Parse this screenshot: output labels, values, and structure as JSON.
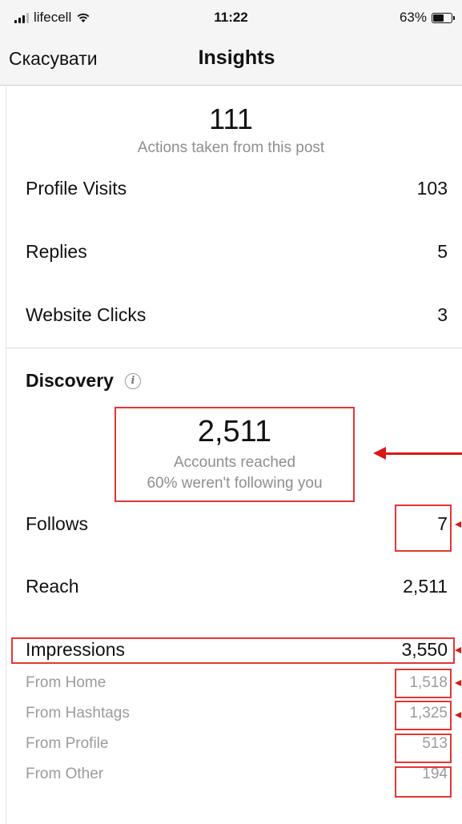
{
  "status_bar": {
    "carrier": "lifecell",
    "time": "11:22",
    "battery_percent": "63%",
    "battery_level": 0.63
  },
  "nav": {
    "cancel_label": "Скасувати",
    "title": "Insights"
  },
  "actions": {
    "total": "111",
    "caption": "Actions taken from this post",
    "rows": [
      {
        "label": "Profile Visits",
        "value": "103"
      },
      {
        "label": "Replies",
        "value": "5"
      },
      {
        "label": "Website Clicks",
        "value": "3"
      }
    ]
  },
  "discovery": {
    "title": "Discovery",
    "accounts_reached": "2,511",
    "reached_caption": "Accounts reached",
    "not_following_caption": "60% weren't following you",
    "follows": {
      "label": "Follows",
      "value": "7"
    },
    "reach": {
      "label": "Reach",
      "value": "2,511"
    },
    "impressions": {
      "label": "Impressions",
      "value": "3,550"
    },
    "sources": [
      {
        "label": "From Home",
        "value": "1,518"
      },
      {
        "label": "From Hashtags",
        "value": "1,325"
      },
      {
        "label": "From Profile",
        "value": "513"
      },
      {
        "label": "From Other",
        "value": "194"
      }
    ]
  },
  "colors": {
    "annotation_red": "#e53535",
    "muted_text": "#8e8e8e"
  }
}
